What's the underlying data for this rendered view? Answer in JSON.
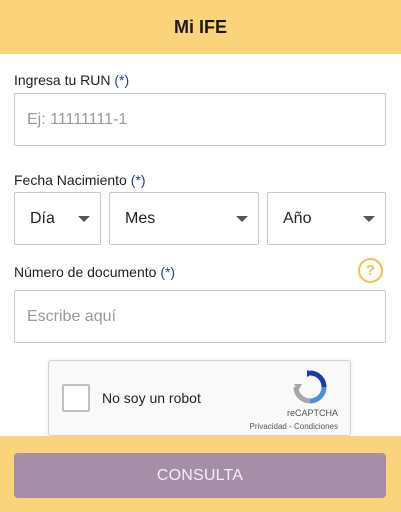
{
  "header": {
    "title": "Mi IFE"
  },
  "run": {
    "label": "Ingresa tu RUN",
    "required": "(*)",
    "placeholder": "Ej: 11111111-1"
  },
  "birth": {
    "label": "Fecha Nacimiento",
    "required": "(*)",
    "day": "Día",
    "month": "Mes",
    "year": "Año"
  },
  "doc": {
    "label": "Número de documento",
    "required": "(*)",
    "placeholder": "Escribe aquí",
    "help_icon": "question-circle-icon"
  },
  "captcha": {
    "text": "No soy un robot",
    "brand": "reCAPTCHA",
    "links": "Privacidad - Condiciones"
  },
  "submit": {
    "label": "CONSULTA"
  },
  "colors": {
    "accent": "#fad37a",
    "button": "#a78ea8",
    "help": "#f0c34a"
  }
}
